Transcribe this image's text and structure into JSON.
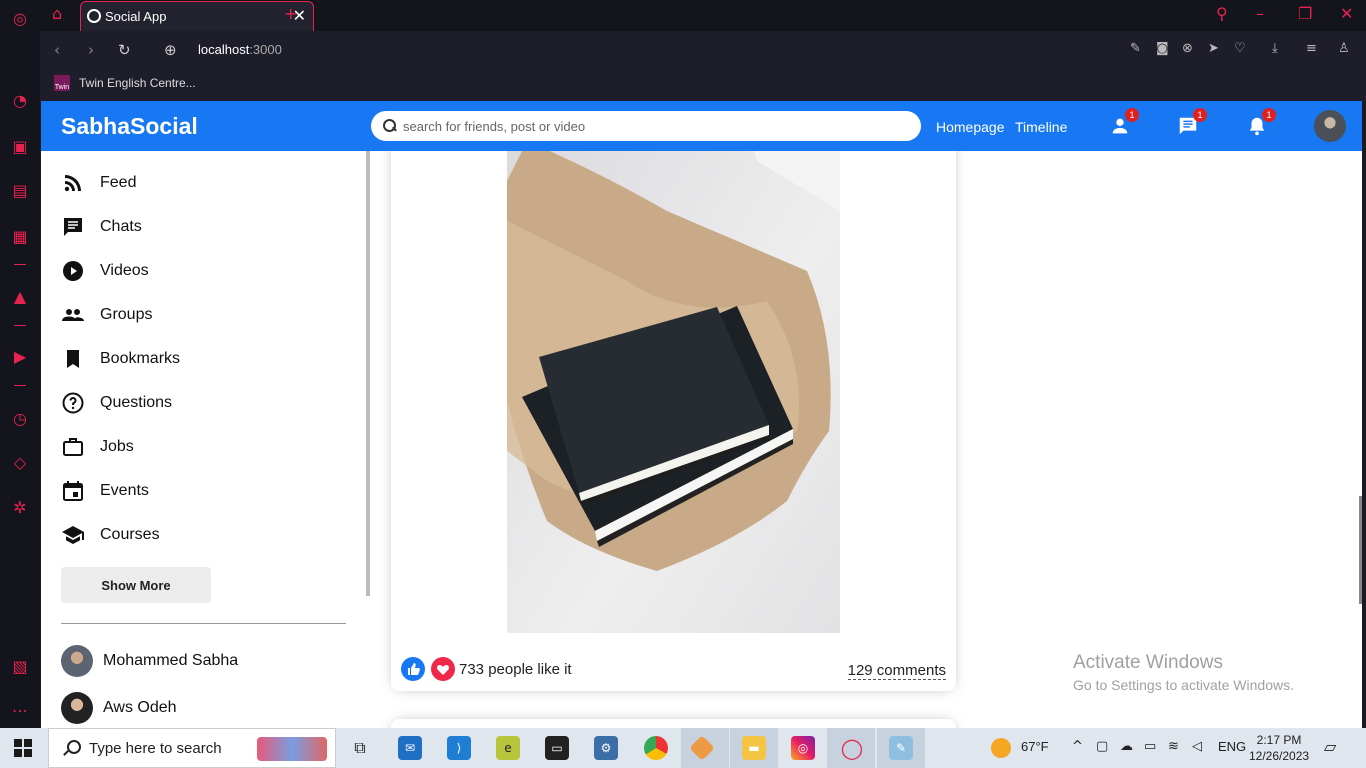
{
  "browser": {
    "tab_title": "Social App",
    "tab_close": "✕",
    "new_tab": "+",
    "url_host": "localhost",
    "url_port": ":3000",
    "bookmark": "Twin English Centre...",
    "bookmark_favicon": "Twin"
  },
  "app": {
    "logo": "SabhaSocial",
    "search_placeholder": "search for friends, post or video",
    "links": [
      "Homepage",
      "Timeline"
    ],
    "badges": {
      "friends": "1",
      "messages": "1",
      "notifications": "1"
    }
  },
  "sidebar": {
    "items": [
      {
        "label": "Feed",
        "icon": "rss-icon"
      },
      {
        "label": "Chats",
        "icon": "chat-icon"
      },
      {
        "label": "Videos",
        "icon": "play-circle-icon"
      },
      {
        "label": "Groups",
        "icon": "group-icon"
      },
      {
        "label": "Bookmarks",
        "icon": "bookmark-icon"
      },
      {
        "label": "Questions",
        "icon": "help-circle-icon"
      },
      {
        "label": "Jobs",
        "icon": "briefcase-icon"
      },
      {
        "label": "Events",
        "icon": "calendar-icon"
      },
      {
        "label": "Courses",
        "icon": "school-icon"
      }
    ],
    "show_more": "Show More",
    "friends": [
      "Mohammed Sabha",
      "Aws Odeh"
    ]
  },
  "post": {
    "likes": "733 people like it",
    "comments": "129 comments"
  },
  "watermark": {
    "line1": "Activate Windows",
    "line2": "Go to Settings to activate Windows."
  },
  "taskbar": {
    "search": "Type here to search",
    "weather": "67°F",
    "lang": "ENG",
    "time": "2:17 PM",
    "date": "12/26/2023"
  },
  "colors": {
    "brand": "#1877f2",
    "gx_accent": "#e6234f"
  }
}
